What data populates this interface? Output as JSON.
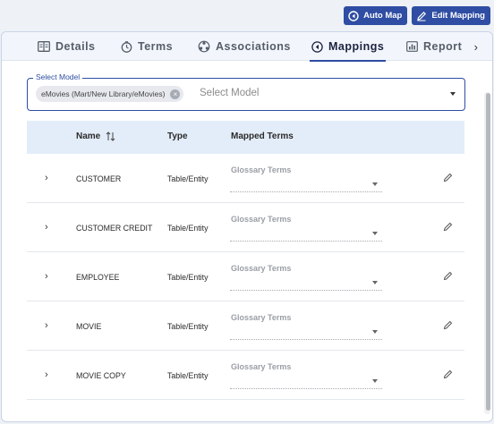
{
  "actions": {
    "auto_map": "Auto Map",
    "edit_mapping": "Edit Mapping"
  },
  "tabs": [
    {
      "label": "Details",
      "icon": "details-icon",
      "active": false
    },
    {
      "label": "Terms",
      "icon": "terms-icon",
      "active": false
    },
    {
      "label": "Associations",
      "icon": "associations-icon",
      "active": false
    },
    {
      "label": "Mappings",
      "icon": "mappings-icon",
      "active": true
    },
    {
      "label": "Report",
      "icon": "report-icon",
      "active": false
    }
  ],
  "select_model": {
    "legend": "Select Model",
    "chip": "eMovies (Mart/New Library/eMovies)",
    "placeholder": "Select Model"
  },
  "table": {
    "headers": {
      "name": "Name",
      "type": "Type",
      "mapped": "Mapped Terms"
    },
    "rows": [
      {
        "name": "CUSTOMER",
        "type": "Table/Entity",
        "glossary": "Glossary Terms"
      },
      {
        "name": "CUSTOMER CREDIT",
        "type": "Table/Entity",
        "glossary": "Glossary Terms"
      },
      {
        "name": "EMPLOYEE",
        "type": "Table/Entity",
        "glossary": "Glossary Terms"
      },
      {
        "name": "MOVIE",
        "type": "Table/Entity",
        "glossary": "Glossary Terms"
      },
      {
        "name": "MOVIE COPY",
        "type": "Table/Entity",
        "glossary": "Glossary Terms"
      }
    ]
  },
  "colors": {
    "accent": "#2f4da3",
    "header_bg": "#e3edf9"
  }
}
